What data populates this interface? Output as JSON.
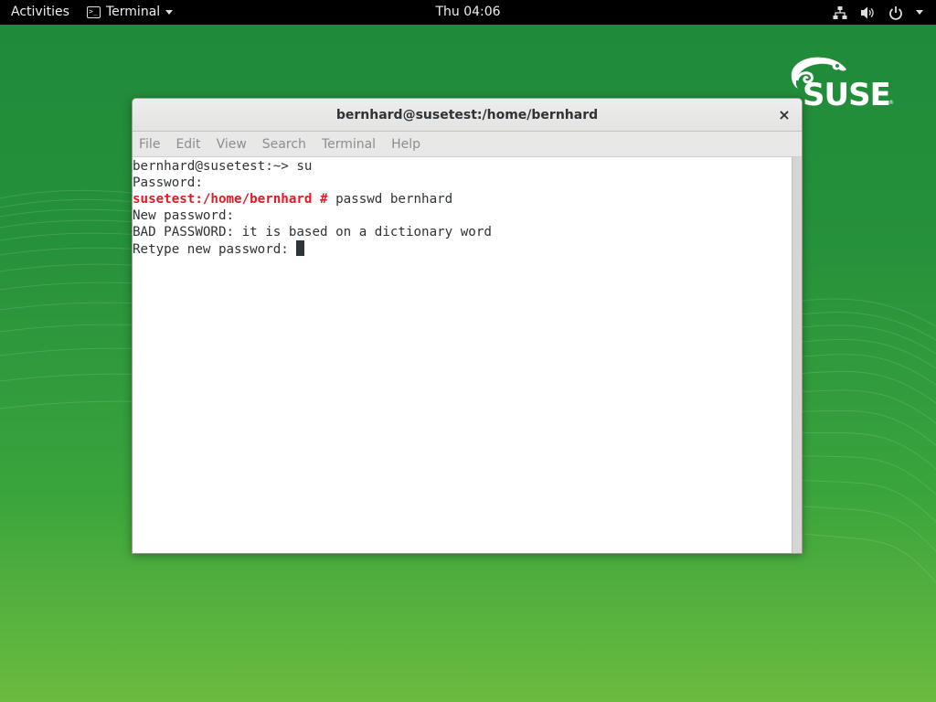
{
  "topbar": {
    "activities": "Activities",
    "app_menu": {
      "icon": "terminal-icon",
      "label": "Terminal"
    },
    "clock": "Thu 04:06",
    "system_icons": [
      "network-icon",
      "volume-icon",
      "power-icon",
      "chevron-down-icon"
    ]
  },
  "window": {
    "title": "bernhard@susetest:/home/bernhard",
    "close_label": "×",
    "menu": {
      "file": "File",
      "edit": "Edit",
      "view": "View",
      "search": "Search",
      "terminal": "Terminal",
      "help": "Help"
    },
    "terminal": {
      "line1": "bernhard@susetest:~> su",
      "line2": "Password:",
      "line3_prompt": "susetest:/home/bernhard #",
      "line3_cmd": " passwd bernhard",
      "line4": "New password:",
      "line5": "BAD PASSWORD: it is based on a dictionary word",
      "line6": "Retype new password: "
    }
  },
  "colors": {
    "desktop_green": "#26913b",
    "root_prompt": "#e01b24",
    "terminal_text": "#2e3436"
  },
  "logo": {
    "icon": "suse-chameleon-logo"
  }
}
